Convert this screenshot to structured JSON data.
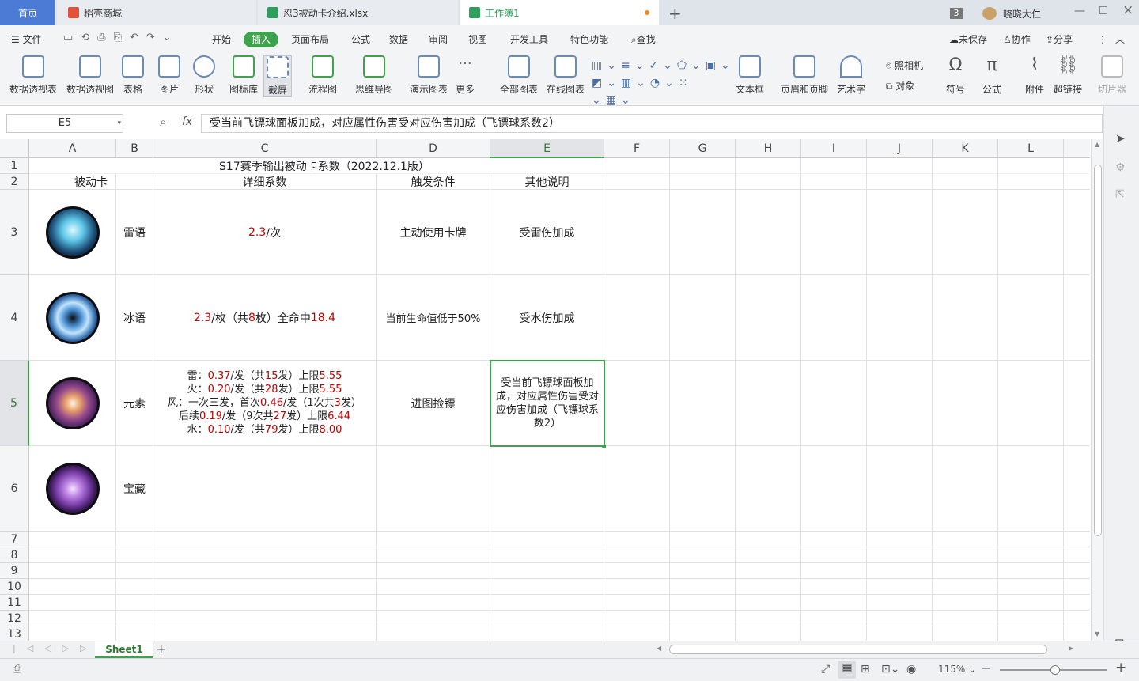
{
  "titlebar": {
    "home_tab": "首页",
    "tabs": [
      "稻壳商城",
      "忍3被动卡介绍.xlsx",
      "工作簿1"
    ],
    "badge": "3",
    "user": "晓晓大仁"
  },
  "menubar": {
    "file": "文件",
    "items": [
      "开始",
      "插入",
      "页面布局",
      "公式",
      "数据",
      "审阅",
      "视图",
      "开发工具",
      "特色功能"
    ],
    "search": "查找",
    "unsaved": "未保存",
    "collab": "协作",
    "share": "分享"
  },
  "toolbar": {
    "tools": [
      "数据透视表",
      "数据透视图",
      "表格",
      "图片",
      "形状",
      "图标库",
      "截屏",
      "流程图",
      "思维导图",
      "演示图表",
      "更多",
      "全部图表",
      "在线图表",
      "文本框",
      "页眉和页脚",
      "艺术字",
      "符号",
      "公式",
      "附件",
      "超链接",
      "切片器"
    ],
    "camera": "照相机",
    "object": "对象"
  },
  "formula_bar": {
    "name_box": "E5",
    "fx": "fx",
    "content": "受当前飞镖球面板加成，对应属性伤害受对应伤害加成（飞镖球系数2）"
  },
  "columns": [
    "A",
    "B",
    "C",
    "D",
    "E",
    "F",
    "G",
    "H",
    "I",
    "J",
    "K",
    "L"
  ],
  "rows": [
    "1",
    "2",
    "3",
    "4",
    "5",
    "6",
    "7",
    "8",
    "9",
    "10",
    "11",
    "12",
    "13"
  ],
  "sheet": {
    "title": "S17赛季输出被动卡系数（2022.12.1版）",
    "headers": [
      "被动卡",
      "详细系数",
      "触发条件",
      "其他说明"
    ],
    "r3": {
      "name": "雷语",
      "c1": "2.3",
      "c2": "/次",
      "trigger": "主动使用卡牌",
      "note": "受雷伤加成"
    },
    "r4": {
      "name": "冰语",
      "c1": "2.3",
      "c2": "/枚（共",
      "c3": "8",
      "c4": "枚）全命中",
      "c5": "18.4",
      "trigger": "当前生命值低于50%",
      "note": "受水伤加成"
    },
    "r5": {
      "name": "元素",
      "l1": [
        "雷：",
        "0.37",
        "/发（共",
        "15",
        "发）上限",
        "5.55"
      ],
      "l2": [
        "火：",
        "0.20",
        "/发（共",
        "28",
        "发）上限",
        "5.55"
      ],
      "l3": [
        "风：一次三发，首次",
        "0.46",
        "/发（1次共",
        "3",
        "发）"
      ],
      "l4": [
        "后续",
        "0.19",
        "/发（9次共",
        "27",
        "发）上限",
        "6.44"
      ],
      "l5": [
        "水：",
        "0.10",
        "/发（共",
        "79",
        "发）上限",
        "8.00"
      ],
      "trigger": "进图捡镖",
      "note": "受当前飞镖球面板加成，对应属性伤害受对应伤害加成（飞镖球系数2）"
    },
    "r6": {
      "name": "宝藏"
    }
  },
  "sheetbar": {
    "sheet_name": "Sheet1",
    "add": "+"
  },
  "statusbar": {
    "zoom": "115%"
  }
}
